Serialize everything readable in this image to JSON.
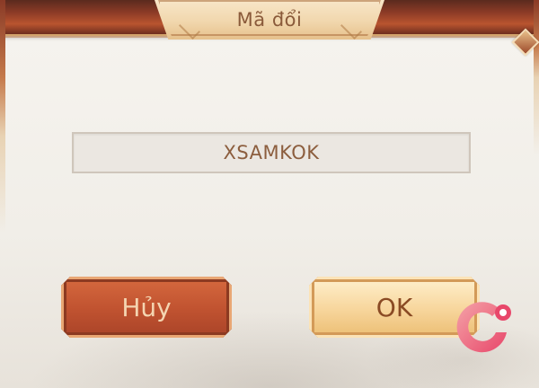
{
  "dialog": {
    "title": "Mã đổi",
    "code_value": "XSAMKOK"
  },
  "buttons": {
    "cancel_label": "Hủy",
    "ok_label": "OK"
  },
  "colors": {
    "frame_red": "#b9542f",
    "title_plate": "#f1d7ad",
    "cancel_button": "#c25431",
    "ok_button": "#f7d59b",
    "text_brown": "#8a5a3a",
    "logo_pink": "#e8476a"
  },
  "icons": {
    "watermark": "g-logo-icon"
  }
}
